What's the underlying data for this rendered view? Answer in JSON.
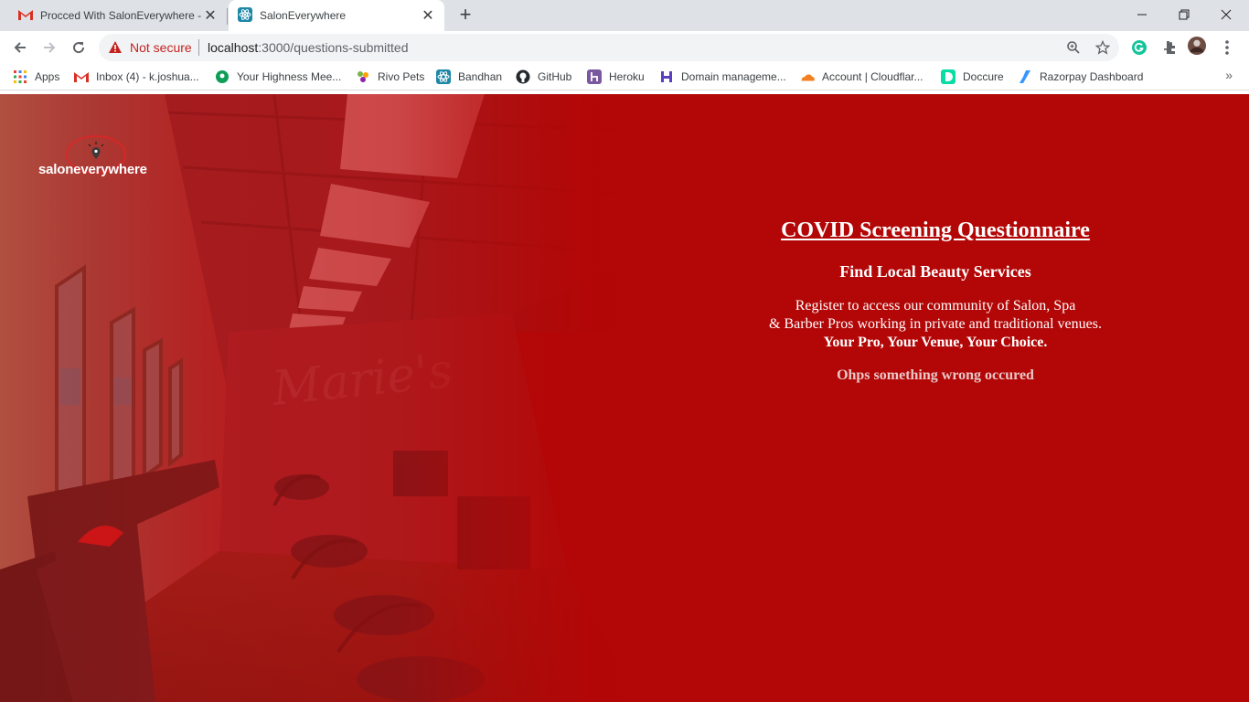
{
  "browser": {
    "tabs": [
      {
        "title": "Procced With SalonEverywhere -",
        "favicon": "gmail-icon",
        "active": false
      },
      {
        "title": "SalonEverywhere",
        "favicon": "react-icon",
        "active": true
      }
    ],
    "address": {
      "security_label": "Not secure",
      "url_host": "localhost",
      "url_rest": ":3000/questions-submitted"
    },
    "bookmarks": [
      {
        "label": "Apps",
        "icon": "apps-grid-icon"
      },
      {
        "label": "Inbox (4) - k.joshua...",
        "icon": "gmail-icon"
      },
      {
        "label": "Your Highness Mee...",
        "icon": "meet-icon"
      },
      {
        "label": "Rivo Pets",
        "icon": "rivo-icon"
      },
      {
        "label": "Bandhan",
        "icon": "react-icon"
      },
      {
        "label": "GitHub",
        "icon": "github-icon"
      },
      {
        "label": "Heroku",
        "icon": "heroku-icon"
      },
      {
        "label": "Domain manageme...",
        "icon": "domain-icon"
      },
      {
        "label": "Account | Cloudflar...",
        "icon": "cloudflare-icon"
      },
      {
        "label": "Doccure",
        "icon": "doccure-icon"
      },
      {
        "label": "Razorpay Dashboard",
        "icon": "razorpay-icon"
      }
    ]
  },
  "page": {
    "logo_text": "saloneverywhere",
    "title": "COVID Screening Questionnaire",
    "subtitle": "Find Local Beauty Services",
    "desc_line1": "Register to access our community of Salon, Spa",
    "desc_line2": "& Barber Pros working in private and traditional venues.",
    "tagline": "Your Pro, Your Venue, Your Choice.",
    "error_message": "Ohps something wrong occured"
  },
  "colors": {
    "page_background": "#b30606",
    "overlay_red": "#c0141a",
    "error_text": "#e9c8c8",
    "not_secure": "#c5221f"
  }
}
